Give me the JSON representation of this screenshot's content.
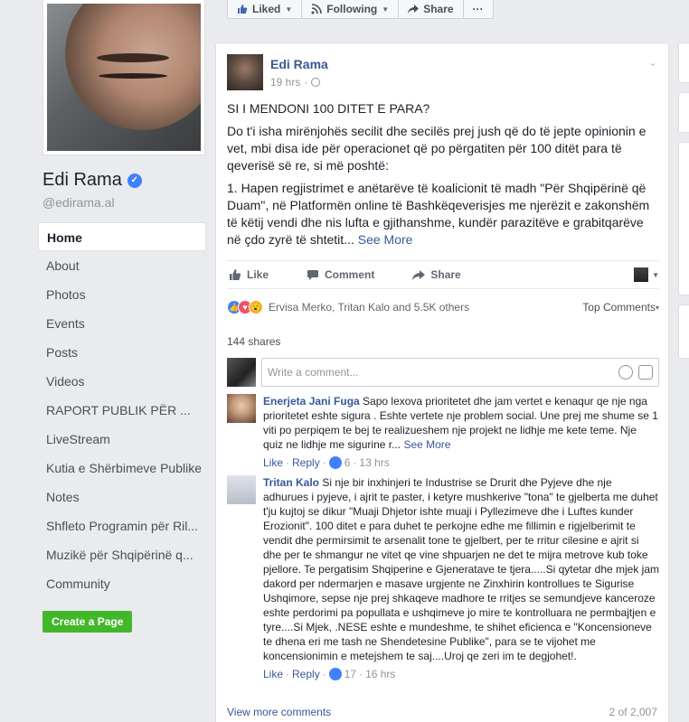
{
  "profile": {
    "name": "Edi Rama",
    "handle": "@edirama.al"
  },
  "nav": [
    "Home",
    "About",
    "Photos",
    "Events",
    "Posts",
    "Videos",
    "RAPORT PUBLIK PËR ...",
    "LiveStream",
    "Kutia e Shërbimeve Publike",
    "Notes",
    "Shfleto Programin për Ril...",
    "Muzikë për Shqipërinë q...",
    "Community"
  ],
  "create_page": "Create a Page",
  "topbar": {
    "liked": "Liked",
    "following": "Following",
    "share": "Share",
    "more": "···"
  },
  "post": {
    "author": "Edi Rama",
    "time": "19 hrs",
    "heading": "SI I MENDONI 100 DITET E PARA?",
    "para1": "Do t'i isha mirënjohës secilit dhe secilës prej jush që do të jepte opinionin e vet, mbi disa ide për operacionet që po përgatiten për 100 ditët para të qeverisë së re, si më poshtë:",
    "para2": "1. Hapen regjistrimet e anëtarëve të koalicionit të madh \"Për Shqipërinë që Duam\", në Platformën online të Bashkëqeverisjes me njerëzit e zakonshëm të këtij vendi dhe nis lufta e gjithanshme, kundër parazitëve e grabitqarëve në çdo zyrë të shtetit...",
    "see_more": "See More",
    "like": "Like",
    "comment": "Comment",
    "share": "Share",
    "reactions": "Ervisa Merko, Tritan Kalo and 5.5K others",
    "top_comments": "Top Comments",
    "shares": "144 shares",
    "comment_placeholder": "Write a comment..."
  },
  "comments": [
    {
      "author": "Enerjeta Jani Fuga",
      "text": "Sapo lexova prioritetet dhe jam vertet e kenaqur qe nje nga prioritetet eshte sigura . Eshte vertete nje problem social. Une prej me shume se 1 viti po perpiqem te bej te realizueshem nje projekt ne lidhje me kete teme. Nje quiz ne lidhje me sigurine r...",
      "see_more": "See More",
      "like": "Like",
      "reply": "Reply",
      "likes": "6",
      "time": "13 hrs"
    },
    {
      "author": "Tritan Kalo",
      "text": "Si nje bir inxhinjeri te Industrise se Drurit dhe Pyjeve dhe nje adhurues i pyjeve, i ajrit te paster, i ketyre mushkerive \"tona\" te gjelberta me duhet t'ju kujtoj se dikur \"Muaji Dhjetor ishte muaji i Pyllezimeve dhe i Luftes kunder Erozionit\". 100 ditet e para duhet te perkojne edhe me fillimin e rigjelberimit te vendit dhe permirsimit te arsenalit tone te gjelbert, per te rritur cilesine e ajrit si dhe per te shmangur ne vitet qe vine shpuarjen ne det te mijra metrove kub toke pjellore. Te pergatisim Shqiperine e Gjeneratave te tjera.....Si qytetar dhe mjek jam dakord per ndermarjen e masave urgjente ne Zinxhirin kontrollues te Sigurise Ushqimore, sepse nje prej shkaqeve madhore te rritjes se semundjeve kanceroze eshte perdorimi pa popullata e ushqimeve jo mire te kontrolluara ne permbajtjen e tyre....Si Mjek, .NESE eshte e mundeshme, te shihet eficienca e \"Koncensioneve te dhena eri me tash ne Shendetesine Publike\", para se te vijohet me koncensionimin e metejshem te saj....Uroj qe zeri im te degjohet!.",
      "like": "Like",
      "reply": "Reply",
      "likes": "17",
      "time": "16 hrs"
    }
  ],
  "view_more": "View more comments",
  "comment_count": "2 of 2,007"
}
